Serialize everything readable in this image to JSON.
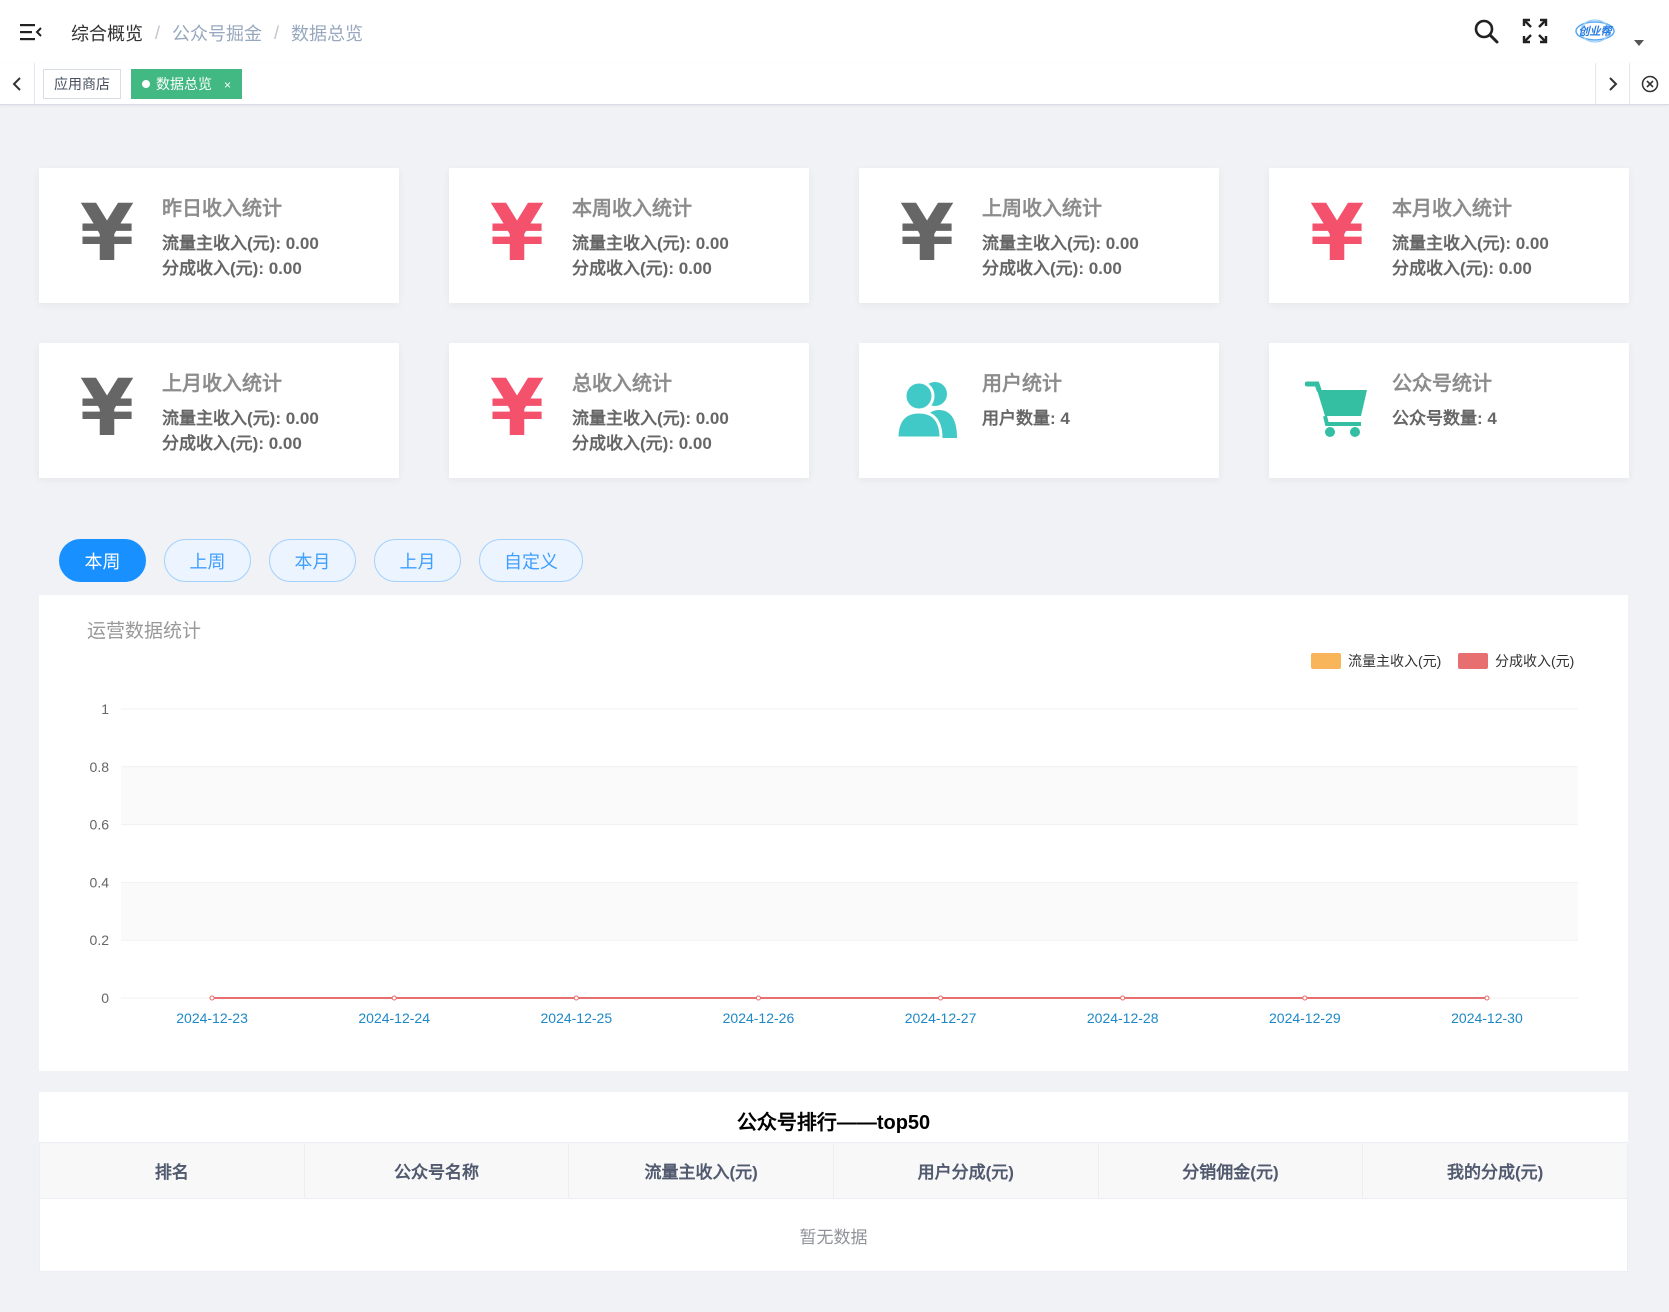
{
  "header": {
    "breadcrumb": [
      "综合概览",
      "公众号掘金",
      "数据总览"
    ],
    "logo_text": "创业帮"
  },
  "tags": {
    "items": [
      {
        "label": "应用商店",
        "active": false
      },
      {
        "label": "数据总览",
        "active": true,
        "close": "×"
      }
    ]
  },
  "cards": [
    {
      "title": "昨日收入统计",
      "line1": "流量主收入(元): 0.00",
      "line2": "分成收入(元): 0.00",
      "icon": "yen-icon",
      "color": "#666666"
    },
    {
      "title": "本周收入统计",
      "line1": "流量主收入(元): 0.00",
      "line2": "分成收入(元): 0.00",
      "icon": "yen-icon",
      "color": "#f4516c"
    },
    {
      "title": "上周收入统计",
      "line1": "流量主收入(元): 0.00",
      "line2": "分成收入(元): 0.00",
      "icon": "yen-icon",
      "color": "#666666"
    },
    {
      "title": "本月收入统计",
      "line1": "流量主收入(元): 0.00",
      "line2": "分成收入(元): 0.00",
      "icon": "yen-icon",
      "color": "#f4516c"
    },
    {
      "title": "上月收入统计",
      "line1": "流量主收入(元): 0.00",
      "line2": "分成收入(元): 0.00",
      "icon": "yen-icon",
      "color": "#666666"
    },
    {
      "title": "总收入统计",
      "line1": "流量主收入(元): 0.00",
      "line2": "分成收入(元): 0.00",
      "icon": "yen-icon",
      "color": "#f4516c"
    },
    {
      "title": "用户统计",
      "line1": "用户数量: 4",
      "line2": "",
      "icon": "users-icon",
      "color": "#40c9c6"
    },
    {
      "title": "公众号统计",
      "line1": "公众号数量: 4",
      "line2": "",
      "icon": "cart-icon",
      "color": "#34bfa3"
    }
  ],
  "period_buttons": [
    {
      "label": "本周",
      "active": true
    },
    {
      "label": "上周",
      "active": false
    },
    {
      "label": "本月",
      "active": false
    },
    {
      "label": "上月",
      "active": false
    },
    {
      "label": "自定义",
      "active": false
    }
  ],
  "chart_data": {
    "type": "line",
    "title": "运营数据统计",
    "x": [
      "2024-12-23",
      "2024-12-24",
      "2024-12-25",
      "2024-12-26",
      "2024-12-27",
      "2024-12-28",
      "2024-12-29",
      "2024-12-30"
    ],
    "series": [
      {
        "name": "流量主收入(元)",
        "color": "#f9b55a",
        "values": [
          0,
          0,
          0,
          0,
          0,
          0,
          0,
          0
        ]
      },
      {
        "name": "分成收入(元)",
        "color": "#e86f6f",
        "values": [
          0,
          0,
          0,
          0,
          0,
          0,
          0,
          0
        ]
      }
    ],
    "yticks": [
      "0",
      "0.2",
      "0.4",
      "0.6",
      "0.8",
      "1"
    ],
    "ylim": [
      0,
      1
    ],
    "legend": "top-right",
    "grid": true
  },
  "ranking": {
    "title": "公众号排行——top50",
    "columns": [
      "排名",
      "公众号名称",
      "流量主收入(元)",
      "用户分成(元)",
      "分销佣金(元)",
      "我的分成(元)"
    ],
    "empty_text": "暂无数据"
  }
}
